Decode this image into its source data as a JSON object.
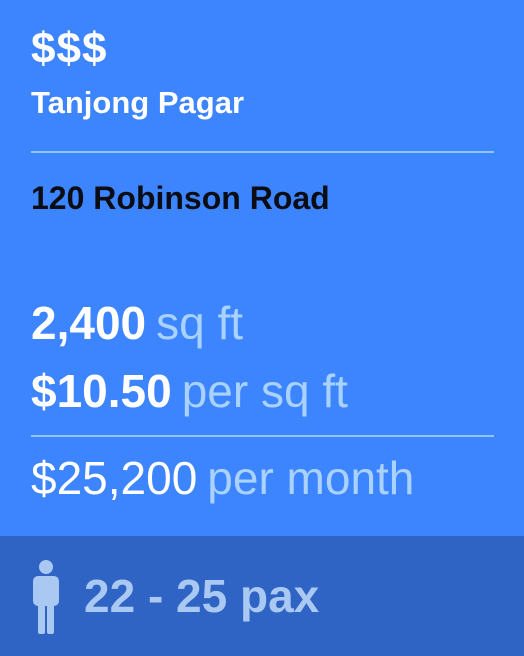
{
  "listing": {
    "price_level": "$$$",
    "district": "Tanjong Pagar",
    "address": "120 Robinson Road",
    "area": {
      "value": "2,400",
      "unit": "sq ft"
    },
    "rate": {
      "value": "$10.50",
      "unit": "per sq ft"
    },
    "monthly": {
      "value": "$25,200",
      "unit": "per month"
    },
    "capacity": "22 - 25 pax"
  },
  "colors": {
    "card_background": "#3d84ff",
    "footer_background": "#2f63c4",
    "divider": "#8fc4ff",
    "accent_text": "#a9d2ff"
  },
  "icons": {
    "capacity": "person-icon"
  }
}
